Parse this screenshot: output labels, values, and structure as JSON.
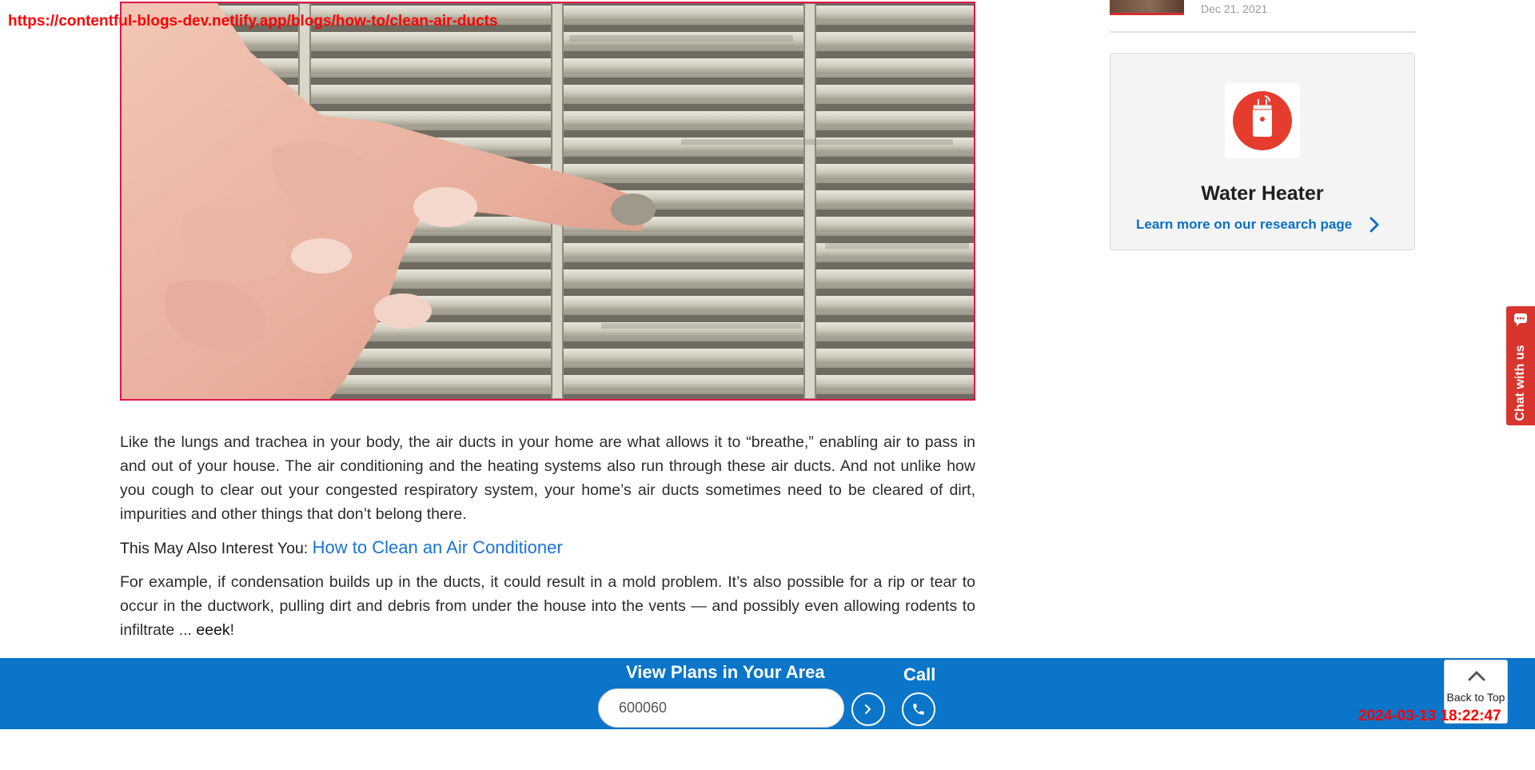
{
  "overlay": {
    "url": "https://contentful-blogs-dev.netlify.app/blogs/how-to/clean-air-ducts",
    "timestamp": "2024-03-13 18:22:47"
  },
  "article": {
    "image_subject": "hand-touching-dusty-air-vent",
    "paragraph_1": "Like the lungs and trachea in your body, the air ducts in your home are what allows it to “breathe,” enabling air to pass in and out of your house. The air conditioning and the heating systems also run through these air ducts. And not unlike how you cough to clear out your congested respiratory system, your home’s air ducts sometimes need to be cleared of dirt, impurities and other things that don’t belong there.",
    "interest_prefix": "This May Also Interest You:",
    "interest_link": "How to Clean an Air Conditioner",
    "paragraph_2_main": "For example, if condensation builds up in the ducts, it could result in a mold problem. It’s also possible for a rip or tear to occur in the ductwork, pulling dirt and debris from under the house into the vents — and possibly even allowing rodents to infiltrate ... ",
    "paragraph_2_emphasis": "eeek",
    "paragraph_2_end": "!"
  },
  "sidebar": {
    "related_date": "Dec 21, 2021",
    "card": {
      "icon": "water-heater-icon",
      "title": "Water Heater",
      "link_label": "Learn more on our research page"
    }
  },
  "chat": {
    "label": "Chat with us"
  },
  "bottom_bar": {
    "title": "View Plans in Your Area",
    "zip_value": "600060",
    "call_label": "Call"
  },
  "back_to_top": {
    "label": "Back to Top"
  },
  "colors": {
    "brand_blue": "#0a75c9",
    "link_blue": "#1a73d9",
    "accent_red": "#d9352f",
    "stamp_red": "#ff0000"
  }
}
